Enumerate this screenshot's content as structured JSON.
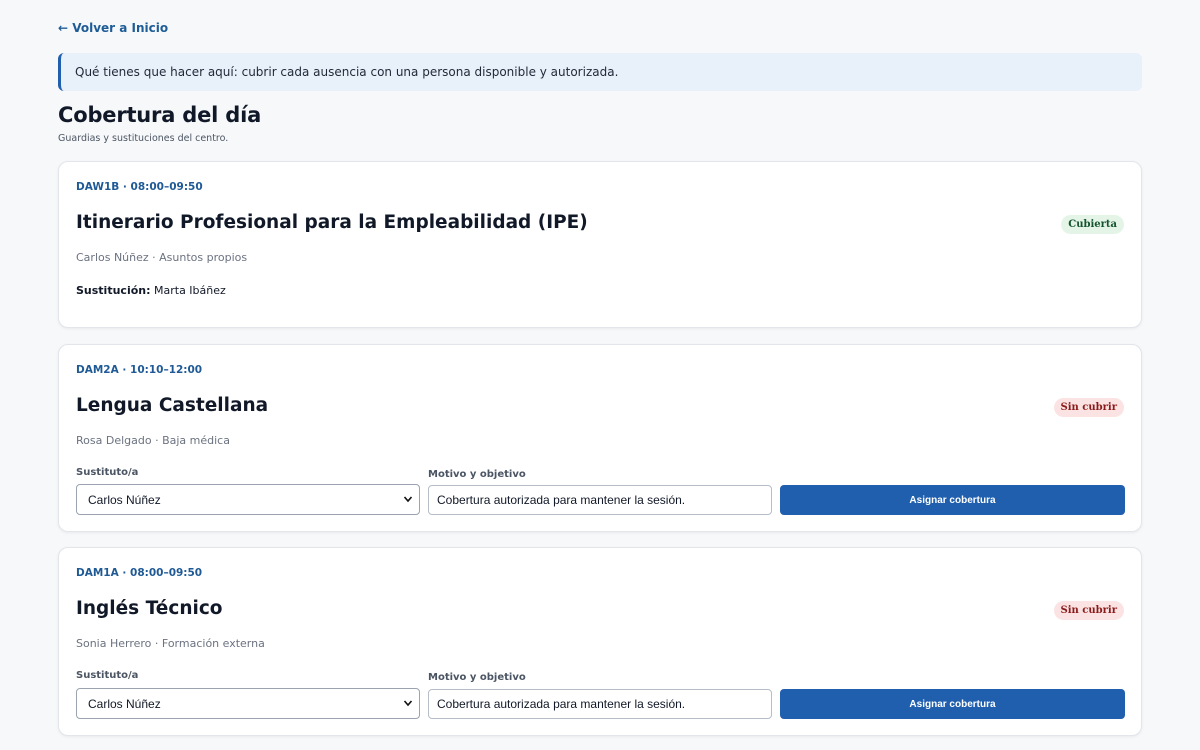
{
  "nav": {
    "back_label": "← Volver a Inicio"
  },
  "info": {
    "text": "Qué tienes que hacer aquí: cubrir cada ausencia con una persona disponible y autorizada."
  },
  "page": {
    "title": "Cobertura del día",
    "subtitle": "Guardias y sustituciones del centro."
  },
  "colors": {
    "accent": "#1f5fae",
    "covered_badge_bg": "#e4f5e8",
    "uncovered_badge_bg": "#fbe3e3"
  },
  "cards": [
    {
      "meta": "DAW1B · 08:00–09:50",
      "subject": "Itinerario Profesional para la Empleabilidad (IPE)",
      "status": "Cubierta",
      "person": "Carlos Núñez · Asuntos propios",
      "substitution_label": "Sustitución:",
      "substitution_value": "Marta Ibáñez"
    },
    {
      "meta": "DAM2A · 10:10–12:00",
      "subject": "Lengua Castellana",
      "status": "Sin cubrir",
      "person": "Rosa Delgado · Baja médica",
      "substitute_label": "Sustituto/a",
      "substitute_value": "Carlos Núñez",
      "reason_label": "Motivo y objetivo",
      "reason_value": "Cobertura autorizada para mantener la sesión.",
      "button_label": "Asignar cobertura"
    },
    {
      "meta": "DAM1A · 08:00–09:50",
      "subject": "Inglés Técnico",
      "status": "Sin cubrir",
      "person": "Sonia Herrero · Formación externa",
      "substitute_label": "Sustituto/a",
      "substitute_value": "Carlos Núñez",
      "reason_label": "Motivo y objetivo",
      "reason_value": "Cobertura autorizada para mantener la sesión.",
      "button_label": "Asignar cobertura"
    }
  ]
}
